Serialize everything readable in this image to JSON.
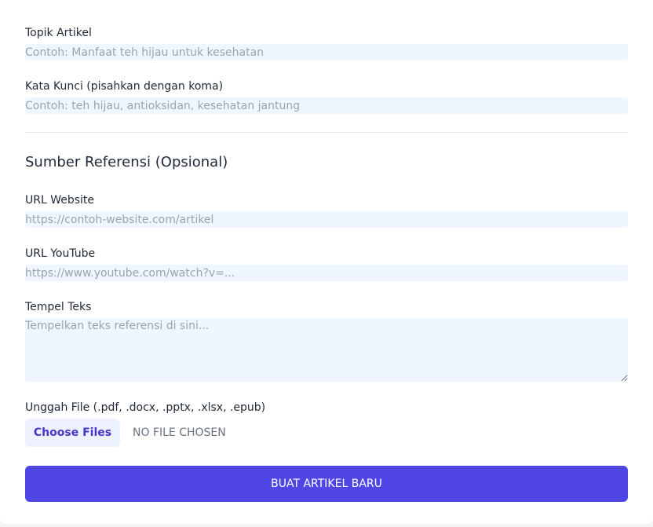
{
  "form": {
    "topic": {
      "label": "Topik Artikel",
      "placeholder": "Contoh: Manfaat teh hijau untuk kesehatan",
      "value": ""
    },
    "keywords": {
      "label": "Kata Kunci (pisahkan dengan koma)",
      "placeholder": "Contoh: teh hijau, antioksidan, kesehatan jantung",
      "value": ""
    }
  },
  "references": {
    "title": "Sumber Referensi (Opsional)",
    "website": {
      "label": "URL Website",
      "placeholder": "https://contoh-website.com/artikel",
      "value": ""
    },
    "youtube": {
      "label": "URL YouTube",
      "placeholder": "https://www.youtube.com/watch?v=...",
      "value": ""
    },
    "paste_text": {
      "label": "Tempel Teks",
      "placeholder": "Tempelkan teks referensi di sini...",
      "value": ""
    },
    "upload": {
      "label": "Unggah File (.pdf, .docx, .pptx, .xlsx, .epub)",
      "button_label": "Choose Files",
      "status": "NO FILE CHOSEN"
    }
  },
  "submit_label": "BUAT ARTIKEL BARU",
  "colors": {
    "accent": "#4f46e5",
    "input_background": "#eff6ff",
    "file_button_background": "#eef2ff",
    "file_button_text": "#4338ca"
  }
}
